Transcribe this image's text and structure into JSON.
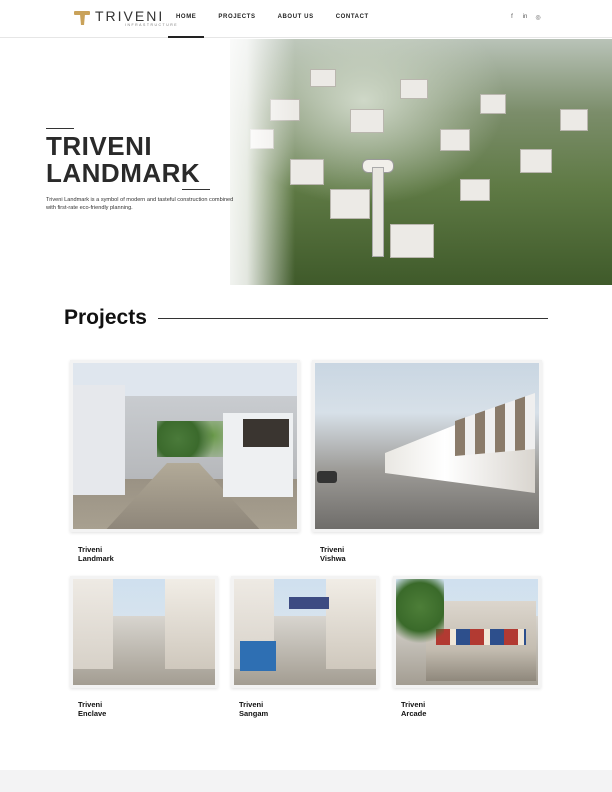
{
  "brand": {
    "name": "TRIVENI",
    "tagline": "INFRASTRUCTURE",
    "accent_color": "#c9a25a"
  },
  "nav": {
    "items": [
      {
        "label": "HOME",
        "active": true
      },
      {
        "label": "PROJECTS",
        "active": false
      },
      {
        "label": "ABOUT US",
        "active": false
      },
      {
        "label": "CONTACT",
        "active": false
      }
    ]
  },
  "social": {
    "facebook": "f",
    "linkedin": "in",
    "instagram": "◎"
  },
  "hero": {
    "title_line1": "TRIVENI",
    "title_line2": "LANDMARK",
    "description": "Triveni Landmark is a symbol of modern and tasteful construction combined with first-rate eco-friendly planning."
  },
  "projects": {
    "heading": "Projects",
    "cards": [
      {
        "name": "Triveni Landmark"
      },
      {
        "name": "Triveni Vishwa"
      },
      {
        "name": "Triveni Enclave"
      },
      {
        "name": "Triveni Sangam"
      },
      {
        "name": "Triveni Arcade"
      }
    ]
  }
}
